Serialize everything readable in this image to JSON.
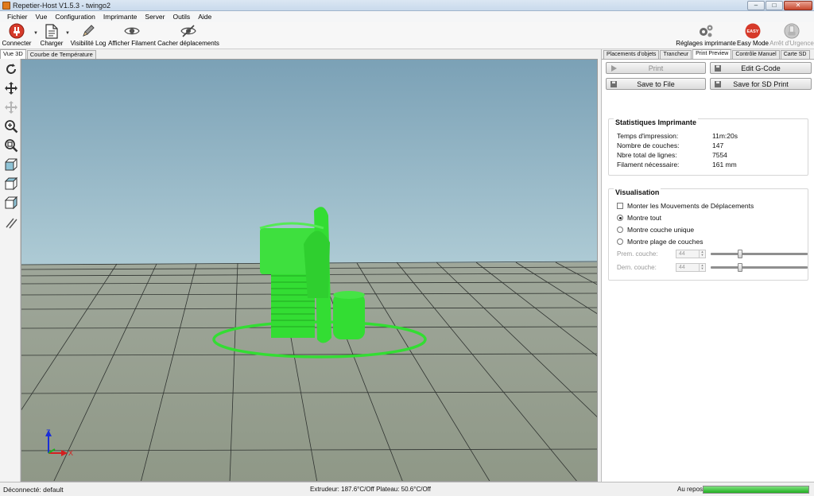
{
  "window": {
    "title": "Repetier-Host V1.5.3 - twingo2",
    "minimize": "–",
    "maximize": "□",
    "close": "✕"
  },
  "menu": [
    {
      "id": "fichier",
      "label": "Fichier"
    },
    {
      "id": "vue",
      "label": "Vue"
    },
    {
      "id": "configuration",
      "label": "Configuration"
    },
    {
      "id": "imprimante",
      "label": "Imprimante"
    },
    {
      "id": "server",
      "label": "Server"
    },
    {
      "id": "outils",
      "label": "Outils"
    },
    {
      "id": "aide",
      "label": "Aide"
    }
  ],
  "toolbar": {
    "connect": "Connecter",
    "load": "Charger",
    "log": "Visibilité Log",
    "filament": "Afficher Filament",
    "travel": "Cacher  déplacements",
    "printer_settings": "Réglages imprimante",
    "easy_mode": "Easy Mode",
    "easy_badge": "EASY",
    "emergency": "Arrêt d'Urgence",
    "accent": "#d63a2a"
  },
  "view_tabs": [
    "Vue 3D",
    "Courbe de Température"
  ],
  "right_tabs": [
    "Placements d'objets",
    "Trancheur",
    "Print Preview",
    "Contrôle Manuel",
    "Carte SD"
  ],
  "buttons": {
    "print": "Print",
    "edit_gcode": "Edit G-Code",
    "save_file": "Save to File",
    "save_sd": "Save for SD Print"
  },
  "stats": {
    "title": "Statistiques Imprimante",
    "rows": [
      {
        "label": "Temps d'impression:",
        "value": "11m:20s"
      },
      {
        "label": "Nombre de couches:",
        "value": "147"
      },
      {
        "label": "Nbre total de lignes:",
        "value": "7554"
      },
      {
        "label": "Filament nécessaire:",
        "value": "161 mm"
      }
    ]
  },
  "visual": {
    "title": "Visualisation",
    "show_travel": "Monter les Mouvements de Déplacements",
    "show_all": "Montre tout",
    "single_layer": "Montre couche unique",
    "layer_range": "Montre plage de couches",
    "first_layer_label": "Prem. couche:",
    "first_layer_value": "44",
    "last_layer_label": "Dern. couche:",
    "last_layer_value": "44",
    "spin_up": "▲",
    "spin_down": "▼"
  },
  "axes": {
    "z": "Z",
    "x": "X"
  },
  "status": {
    "connection": "Déconnecté: default",
    "temps": "Extrudeur: 187.6°C/Off Plateau: 50.6°C/Off",
    "state": "Au repos",
    "progress": 1.0
  },
  "colors": {
    "object": "#33dd33",
    "sky_top": "#7fa4b8",
    "sky_bottom": "#a9c8d3",
    "floor": "#9ea696",
    "progress": "#22b022"
  }
}
